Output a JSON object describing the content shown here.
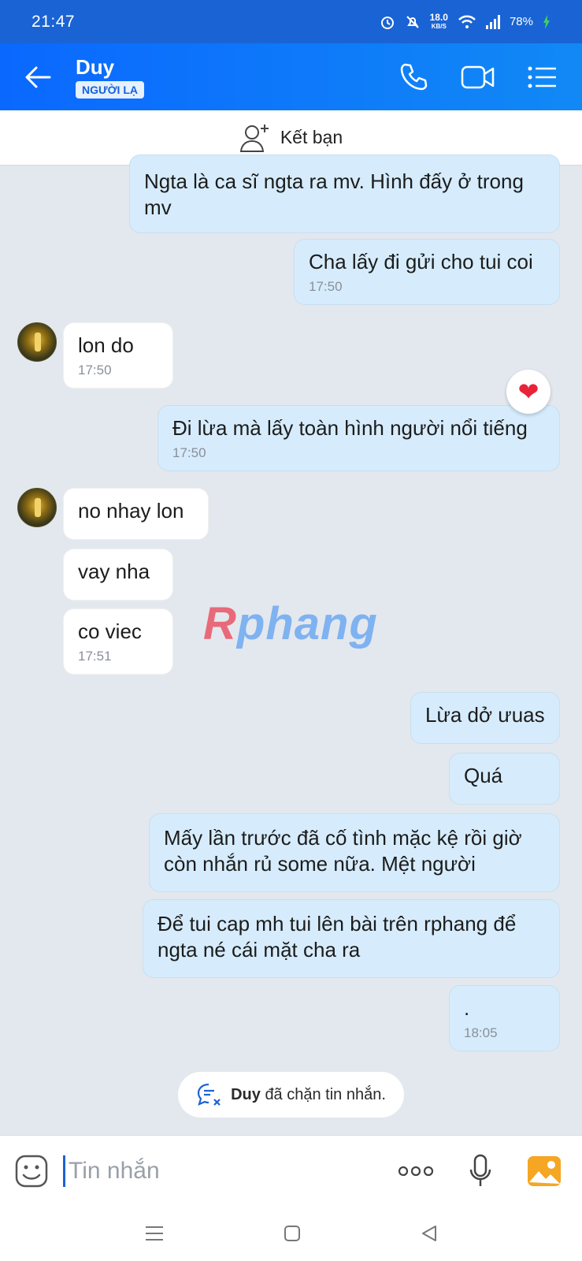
{
  "status_bar": {
    "time": "21:47",
    "net_speed_value": "18.0",
    "net_speed_unit": "KB/S",
    "battery": "78%",
    "icons": [
      "alarm-icon",
      "mute-icon",
      "wifi-icon",
      "signal-icon",
      "charging-icon"
    ]
  },
  "header": {
    "contact_name": "Duy",
    "badge": "NGƯỜI LẠ",
    "actions": [
      "phone-icon",
      "video-icon",
      "menu-icon"
    ]
  },
  "add_friend": {
    "label": "Kết bạn"
  },
  "messages": [
    {
      "dir": "out",
      "text": "Ngta là ca sĩ ngta ra mv. Hình đấy ở trong mv",
      "time": ""
    },
    {
      "dir": "out",
      "text": "Cha lấy đi gửi cho tui coi",
      "time": "17:50"
    },
    {
      "dir": "in",
      "text": "lon do",
      "time": "17:50"
    },
    {
      "dir": "out",
      "text": "Đi lừa mà lấy toàn hình người nổi tiếng",
      "time": "17:50",
      "reaction": "heart"
    },
    {
      "dir": "in",
      "text": "no nhay lon",
      "time": ""
    },
    {
      "dir": "in",
      "text": "vay nha",
      "time": ""
    },
    {
      "dir": "in",
      "text": "co viec",
      "time": "17:51"
    },
    {
      "dir": "out",
      "text": "Lừa dở ưuas",
      "time": ""
    },
    {
      "dir": "out",
      "text": "Quá",
      "time": ""
    },
    {
      "dir": "out",
      "text": "Mấy lần trước đã cố tình mặc kệ rồi giờ còn nhắn rủ some nữa. Mệt người",
      "time": ""
    },
    {
      "dir": "out",
      "text": "Để tui cap mh tui lên bài trên rphang để ngta né cái mặt cha ra",
      "time": ""
    },
    {
      "dir": "out",
      "text": ".",
      "time": "18:05"
    }
  ],
  "watermark": {
    "first": "R",
    "rest": "phang"
  },
  "system_note": {
    "name": "Duy",
    "text": "đã chặn tin nhắn."
  },
  "composer": {
    "placeholder": "Tin nhắn",
    "actions": [
      "more-icon",
      "microphone-icon",
      "image-icon"
    ]
  },
  "colors": {
    "header": "#0a68ff",
    "status_bar": "#1a63d4",
    "outgoing_bubble": "#d6ecfc",
    "incoming_bubble": "#ffffff",
    "chat_bg": "#e3e8ee",
    "heart": "#e8233a"
  }
}
